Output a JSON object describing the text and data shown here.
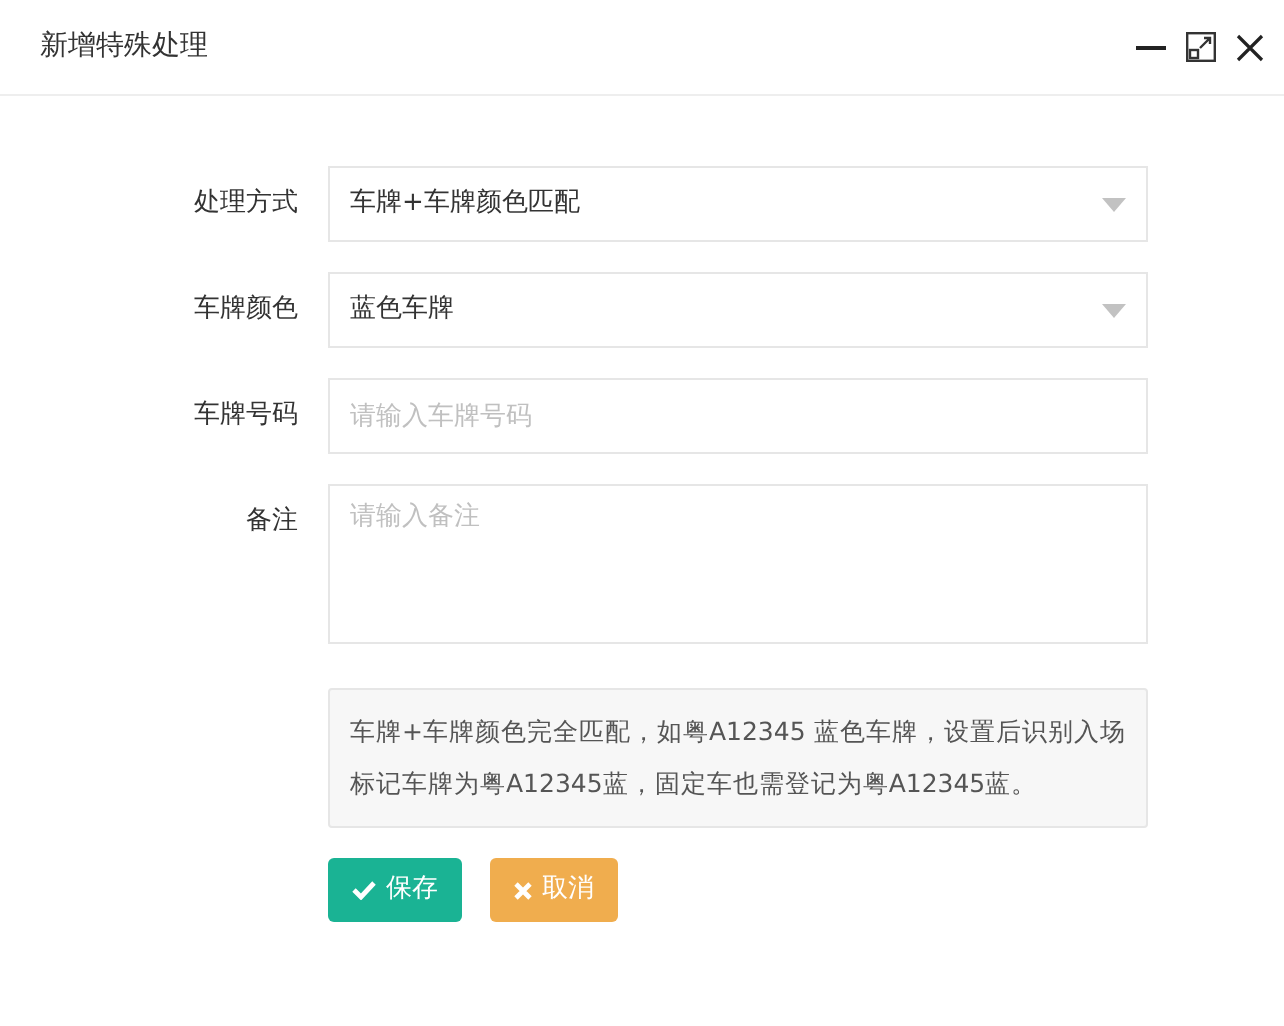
{
  "window": {
    "title": "新增特殊处理"
  },
  "fields": [
    {
      "kind": "select",
      "label": "处理方式",
      "value": "车牌+车牌颜色匹配"
    },
    {
      "kind": "select",
      "label": "车牌颜色",
      "value": "蓝色车牌"
    },
    {
      "kind": "input",
      "label": "车牌号码",
      "placeholder": "请输入车牌号码"
    },
    {
      "kind": "textarea",
      "label": "备注",
      "placeholder": "请输入备注"
    }
  ],
  "note": "车牌+车牌颜色完全匹配，如粤A12345 蓝色车牌，设置后识别入场标记车牌为粤A12345蓝，固定车也需登记为粤A12345蓝。",
  "buttons": [
    {
      "kind": "save",
      "label": "保存"
    },
    {
      "kind": "cancel",
      "label": "取消"
    }
  ]
}
